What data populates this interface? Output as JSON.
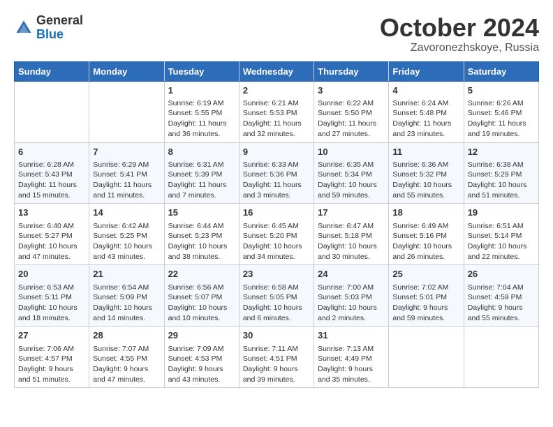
{
  "header": {
    "logo_general": "General",
    "logo_blue": "Blue",
    "month_title": "October 2024",
    "location": "Zavoronezhskoye, Russia"
  },
  "days_of_week": [
    "Sunday",
    "Monday",
    "Tuesday",
    "Wednesday",
    "Thursday",
    "Friday",
    "Saturday"
  ],
  "weeks": [
    [
      {
        "day": "",
        "info": ""
      },
      {
        "day": "",
        "info": ""
      },
      {
        "day": "1",
        "info": "Sunrise: 6:19 AM\nSunset: 5:55 PM\nDaylight: 11 hours and 36 minutes."
      },
      {
        "day": "2",
        "info": "Sunrise: 6:21 AM\nSunset: 5:53 PM\nDaylight: 11 hours and 32 minutes."
      },
      {
        "day": "3",
        "info": "Sunrise: 6:22 AM\nSunset: 5:50 PM\nDaylight: 11 hours and 27 minutes."
      },
      {
        "day": "4",
        "info": "Sunrise: 6:24 AM\nSunset: 5:48 PM\nDaylight: 11 hours and 23 minutes."
      },
      {
        "day": "5",
        "info": "Sunrise: 6:26 AM\nSunset: 5:46 PM\nDaylight: 11 hours and 19 minutes."
      }
    ],
    [
      {
        "day": "6",
        "info": "Sunrise: 6:28 AM\nSunset: 5:43 PM\nDaylight: 11 hours and 15 minutes."
      },
      {
        "day": "7",
        "info": "Sunrise: 6:29 AM\nSunset: 5:41 PM\nDaylight: 11 hours and 11 minutes."
      },
      {
        "day": "8",
        "info": "Sunrise: 6:31 AM\nSunset: 5:39 PM\nDaylight: 11 hours and 7 minutes."
      },
      {
        "day": "9",
        "info": "Sunrise: 6:33 AM\nSunset: 5:36 PM\nDaylight: 11 hours and 3 minutes."
      },
      {
        "day": "10",
        "info": "Sunrise: 6:35 AM\nSunset: 5:34 PM\nDaylight: 10 hours and 59 minutes."
      },
      {
        "day": "11",
        "info": "Sunrise: 6:36 AM\nSunset: 5:32 PM\nDaylight: 10 hours and 55 minutes."
      },
      {
        "day": "12",
        "info": "Sunrise: 6:38 AM\nSunset: 5:29 PM\nDaylight: 10 hours and 51 minutes."
      }
    ],
    [
      {
        "day": "13",
        "info": "Sunrise: 6:40 AM\nSunset: 5:27 PM\nDaylight: 10 hours and 47 minutes."
      },
      {
        "day": "14",
        "info": "Sunrise: 6:42 AM\nSunset: 5:25 PM\nDaylight: 10 hours and 43 minutes."
      },
      {
        "day": "15",
        "info": "Sunrise: 6:44 AM\nSunset: 5:23 PM\nDaylight: 10 hours and 38 minutes."
      },
      {
        "day": "16",
        "info": "Sunrise: 6:45 AM\nSunset: 5:20 PM\nDaylight: 10 hours and 34 minutes."
      },
      {
        "day": "17",
        "info": "Sunrise: 6:47 AM\nSunset: 5:18 PM\nDaylight: 10 hours and 30 minutes."
      },
      {
        "day": "18",
        "info": "Sunrise: 6:49 AM\nSunset: 5:16 PM\nDaylight: 10 hours and 26 minutes."
      },
      {
        "day": "19",
        "info": "Sunrise: 6:51 AM\nSunset: 5:14 PM\nDaylight: 10 hours and 22 minutes."
      }
    ],
    [
      {
        "day": "20",
        "info": "Sunrise: 6:53 AM\nSunset: 5:11 PM\nDaylight: 10 hours and 18 minutes."
      },
      {
        "day": "21",
        "info": "Sunrise: 6:54 AM\nSunset: 5:09 PM\nDaylight: 10 hours and 14 minutes."
      },
      {
        "day": "22",
        "info": "Sunrise: 6:56 AM\nSunset: 5:07 PM\nDaylight: 10 hours and 10 minutes."
      },
      {
        "day": "23",
        "info": "Sunrise: 6:58 AM\nSunset: 5:05 PM\nDaylight: 10 hours and 6 minutes."
      },
      {
        "day": "24",
        "info": "Sunrise: 7:00 AM\nSunset: 5:03 PM\nDaylight: 10 hours and 2 minutes."
      },
      {
        "day": "25",
        "info": "Sunrise: 7:02 AM\nSunset: 5:01 PM\nDaylight: 9 hours and 59 minutes."
      },
      {
        "day": "26",
        "info": "Sunrise: 7:04 AM\nSunset: 4:59 PM\nDaylight: 9 hours and 55 minutes."
      }
    ],
    [
      {
        "day": "27",
        "info": "Sunrise: 7:06 AM\nSunset: 4:57 PM\nDaylight: 9 hours and 51 minutes."
      },
      {
        "day": "28",
        "info": "Sunrise: 7:07 AM\nSunset: 4:55 PM\nDaylight: 9 hours and 47 minutes."
      },
      {
        "day": "29",
        "info": "Sunrise: 7:09 AM\nSunset: 4:53 PM\nDaylight: 9 hours and 43 minutes."
      },
      {
        "day": "30",
        "info": "Sunrise: 7:11 AM\nSunset: 4:51 PM\nDaylight: 9 hours and 39 minutes."
      },
      {
        "day": "31",
        "info": "Sunrise: 7:13 AM\nSunset: 4:49 PM\nDaylight: 9 hours and 35 minutes."
      },
      {
        "day": "",
        "info": ""
      },
      {
        "day": "",
        "info": ""
      }
    ]
  ]
}
